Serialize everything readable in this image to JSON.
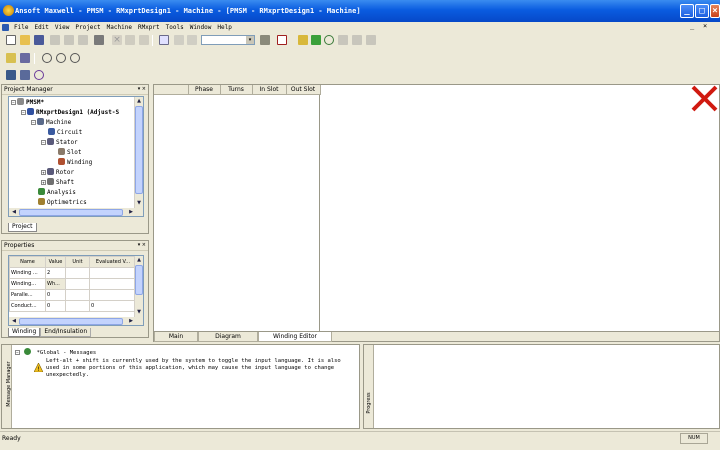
{
  "window": {
    "title": "Ansoft Maxwell - PMSM - RMxprtDesign1 - Machine - [PMSM - RMxprtDesign1 - Machine]",
    "buttons": {
      "minimize": "_",
      "maximize": "□",
      "close": "×"
    }
  },
  "menubar": {
    "items": [
      "File",
      "Edit",
      "View",
      "Project",
      "Machine",
      "RMxprt",
      "Tools",
      "Window",
      "Help"
    ],
    "mdi_buttons": [
      "_",
      "×"
    ]
  },
  "toolbar": {
    "combo_value": "",
    "combo_arrow": "▾"
  },
  "project_manager": {
    "title": "Project Manager",
    "header_buttons": "▾ ×",
    "tree": [
      {
        "label": "PMSM*",
        "level": 0,
        "icon": "project-icon",
        "color": "#8a8a8a"
      },
      {
        "label": "RMxprtDesign1 (Adjust-S",
        "level": 1,
        "icon": "design-icon",
        "color": "#3050a0"
      },
      {
        "label": "Machine",
        "level": 2,
        "icon": "machine-icon",
        "color": "#5a6a8a"
      },
      {
        "label": "Circuit",
        "level": 3,
        "icon": "circuit-icon",
        "color": "#3a5aa0"
      },
      {
        "label": "Stator",
        "level": 3,
        "icon": "stator-icon",
        "color": "#5a5a7a"
      },
      {
        "label": "Slot",
        "level": 4,
        "icon": "slot-icon",
        "color": "#8a7a6a"
      },
      {
        "label": "Winding",
        "level": 4,
        "icon": "winding-icon",
        "color": "#b05030"
      },
      {
        "label": "Rotor",
        "level": 3,
        "icon": "rotor-icon",
        "color": "#5a5a7a"
      },
      {
        "label": "Shaft",
        "level": 3,
        "icon": "shaft-icon",
        "color": "#707070"
      },
      {
        "label": "Analysis",
        "level": 2,
        "icon": "analysis-icon",
        "color": "#3a8a3a"
      },
      {
        "label": "Optimetrics",
        "level": 2,
        "icon": "optimetrics-icon",
        "color": "#a08030"
      }
    ],
    "tabs": [
      "Project"
    ]
  },
  "properties": {
    "title": "Properties",
    "header_buttons": "▾ ×",
    "columns": [
      "Name",
      "Value",
      "Unit",
      "Evaluated V..."
    ],
    "rows": [
      [
        "Winding ...",
        "2",
        "",
        ""
      ],
      [
        "Winding...",
        "Wh...",
        "",
        ""
      ],
      [
        "Paralle...",
        "0",
        "",
        ""
      ],
      [
        "Conduct...",
        "0",
        "",
        "0"
      ]
    ],
    "tabs": [
      "Winding",
      "End/Insulation"
    ]
  },
  "winding_editor": {
    "columns": [
      "Phase",
      "Turns",
      "In Slot",
      "Out Slot"
    ],
    "tabs": [
      "Main",
      "Diagram",
      "Winding Editor"
    ],
    "active_tab": "Winding Editor"
  },
  "messages": {
    "side_label": "Message Manager",
    "group": "*Global - Messages",
    "text": "Left-alt + shift is currently used by the system to toggle the input language. It is also used in some portions of this application, which may cause the input language to change unexpectedly."
  },
  "progress": {
    "side_label": "Progress"
  },
  "status": {
    "text": "Ready",
    "indicator": "NUM"
  },
  "colors": {
    "accent": "#0a5ce0",
    "error_x": "#d01a10"
  }
}
